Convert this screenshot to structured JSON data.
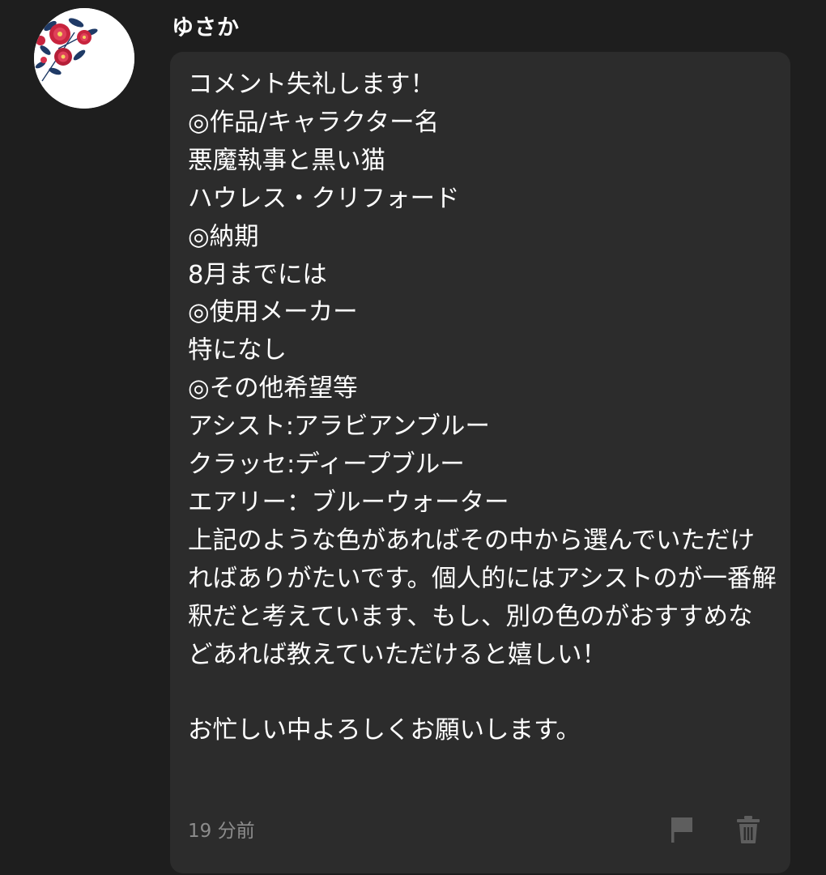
{
  "comment": {
    "author": "ゆさか",
    "body": "コメント失礼します！\n◎作品/キャラクター名\n悪魔執事と黒い猫\nハウレス・クリフォード\n◎納期\n8月までには\n◎使用メーカー\n特になし\n◎その他希望等\nアシスト:アラビアンブルー\nクラッセ:ディープブルー\nエアリー：ブルーウォーター\n上記のような色があればその中から選んでいただければありがたいです。個人的にはアシストのが一番解釈だと考えています、もし、別の色のがおすすめなどあれば教えていただけると嬉しい！\n\nお忙しい中よろしくお願いします。",
    "timestamp": "19 分前"
  },
  "icons": {
    "avatar": "camellia-flower-avatar",
    "flag": "flag-icon",
    "delete": "trash-icon"
  },
  "colors": {
    "background": "#1e1e1e",
    "bubble": "#2c2c2c",
    "text": "#ffffff",
    "muted": "#8c8c8c",
    "icon": "#5e5e5e"
  }
}
